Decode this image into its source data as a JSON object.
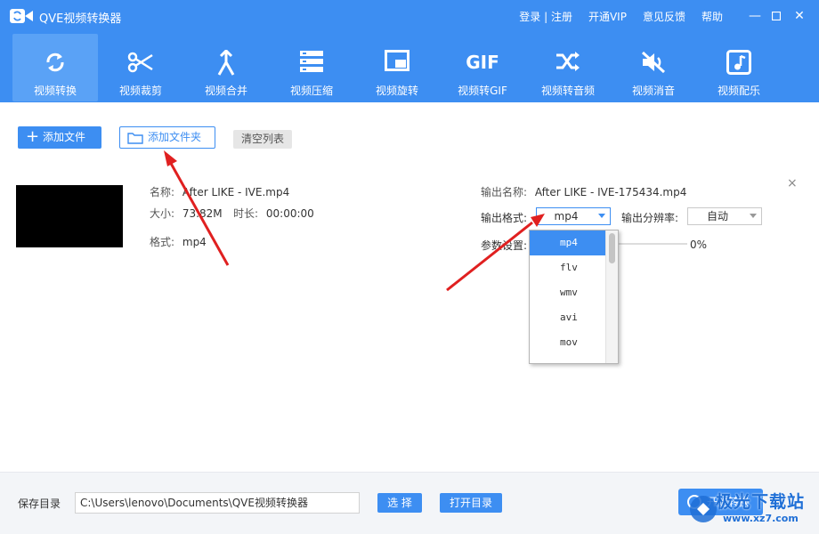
{
  "app": {
    "title": "QVE视频转换器",
    "links": [
      "登录 | 注册",
      "开通VIP",
      "意见反馈",
      "帮助"
    ]
  },
  "toolbar": {
    "items": [
      {
        "label": "视频转换",
        "icon": "convert-icon"
      },
      {
        "label": "视频裁剪",
        "icon": "scissors-icon"
      },
      {
        "label": "视频合并",
        "icon": "merge-icon"
      },
      {
        "label": "视频压缩",
        "icon": "compress-icon"
      },
      {
        "label": "视频旋转",
        "icon": "rotate-icon"
      },
      {
        "label": "视频转GIF",
        "icon": "gif-icon"
      },
      {
        "label": "视频转音频",
        "icon": "shuffle-icon"
      },
      {
        "label": "视频消音",
        "icon": "mute-icon"
      },
      {
        "label": "视频配乐",
        "icon": "music-icon"
      }
    ],
    "gif_text": "GIF"
  },
  "actions": {
    "add_file": "添加文件",
    "add_folder": "添加文件夹",
    "clear_list": "清空列表"
  },
  "file": {
    "name_label": "名称:",
    "name": "After LIKE - IVE.mp4",
    "size_label": "大小:",
    "size": "73.82M",
    "duration_label": "时长:",
    "duration": "00:00:00",
    "format_label": "格式:",
    "format": "mp4",
    "output_name_label": "输出名称:",
    "output_name": "After LIKE - IVE-175434.mp4",
    "output_format_label": "输出格式:",
    "output_format": "mp4",
    "resolution_label": "输出分辨率:",
    "resolution": "自动",
    "params_label": "参数设置:",
    "progress": "0%",
    "progress_value": 0
  },
  "format_dropdown": {
    "options": [
      "mp4",
      "flv",
      "wmv",
      "avi",
      "mov"
    ],
    "selected": "mp4"
  },
  "bottom": {
    "save_label": "保存目录",
    "path": "C:\\Users\\lenovo\\Documents\\QVE视频转换器",
    "choose": "选 择",
    "open_dir": "打开目录",
    "start": "开始转换"
  },
  "watermark": {
    "text": "极光下载站",
    "url": "www.xz7.com"
  },
  "colors": {
    "accent": "#3d8ef2",
    "arrow": "#e02020"
  }
}
